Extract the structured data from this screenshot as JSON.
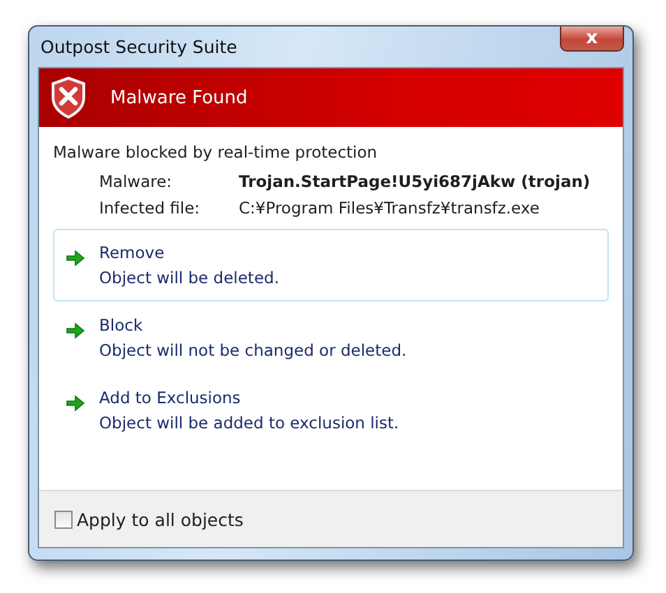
{
  "window": {
    "title": "Outpost Security Suite",
    "close_label": "x"
  },
  "banner": {
    "title": "Malware Found"
  },
  "message": "Malware blocked by real-time protection",
  "details": [
    {
      "label": "Malware:",
      "value": "Trojan.StartPage!U5yi687jAkw (trojan)",
      "bold": true
    },
    {
      "label": "Infected file:",
      "value": "C:¥Program Files¥Transfz¥transfz.exe",
      "bold": false
    }
  ],
  "actions": [
    {
      "title": "Remove",
      "description": "Object will be deleted.",
      "selected": true
    },
    {
      "title": "Block",
      "description": "Object will not be changed or deleted.",
      "selected": false
    },
    {
      "title": "Add to Exclusions",
      "description": "Object will be added to exclusion list.",
      "selected": false
    }
  ],
  "apply_all": {
    "label": "Apply to all objects",
    "checked": false
  }
}
